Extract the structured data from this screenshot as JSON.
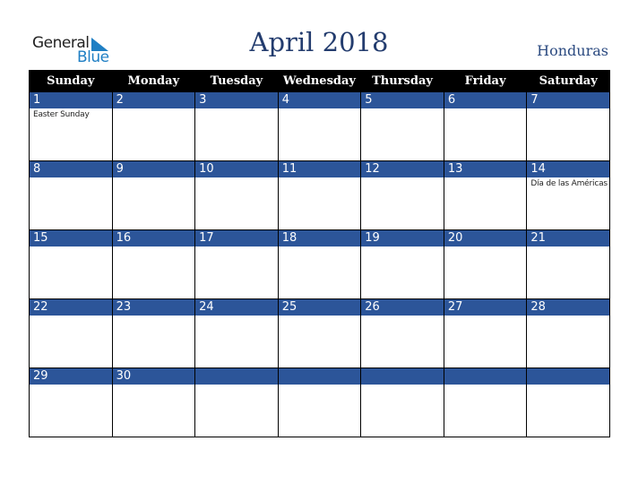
{
  "logo": {
    "word1": "General",
    "word2": "Blue",
    "icon": "triangle-flag-icon"
  },
  "title": "April 2018",
  "country": "Honduras",
  "colors": {
    "header_bg": "#000000",
    "day_bar": "#2c5599",
    "title": "#233c6e",
    "logo_blue": "#1f7fc4"
  },
  "weekdays": [
    "Sunday",
    "Monday",
    "Tuesday",
    "Wednesday",
    "Thursday",
    "Friday",
    "Saturday"
  ],
  "weeks": [
    [
      {
        "day": "1",
        "holiday": "Easter Sunday"
      },
      {
        "day": "2",
        "holiday": ""
      },
      {
        "day": "3",
        "holiday": ""
      },
      {
        "day": "4",
        "holiday": ""
      },
      {
        "day": "5",
        "holiday": ""
      },
      {
        "day": "6",
        "holiday": ""
      },
      {
        "day": "7",
        "holiday": ""
      }
    ],
    [
      {
        "day": "8",
        "holiday": ""
      },
      {
        "day": "9",
        "holiday": ""
      },
      {
        "day": "10",
        "holiday": ""
      },
      {
        "day": "11",
        "holiday": ""
      },
      {
        "day": "12",
        "holiday": ""
      },
      {
        "day": "13",
        "holiday": ""
      },
      {
        "day": "14",
        "holiday": "Día de las Américas"
      }
    ],
    [
      {
        "day": "15",
        "holiday": ""
      },
      {
        "day": "16",
        "holiday": ""
      },
      {
        "day": "17",
        "holiday": ""
      },
      {
        "day": "18",
        "holiday": ""
      },
      {
        "day": "19",
        "holiday": ""
      },
      {
        "day": "20",
        "holiday": ""
      },
      {
        "day": "21",
        "holiday": ""
      }
    ],
    [
      {
        "day": "22",
        "holiday": ""
      },
      {
        "day": "23",
        "holiday": ""
      },
      {
        "day": "24",
        "holiday": ""
      },
      {
        "day": "25",
        "holiday": ""
      },
      {
        "day": "26",
        "holiday": ""
      },
      {
        "day": "27",
        "holiday": ""
      },
      {
        "day": "28",
        "holiday": ""
      }
    ],
    [
      {
        "day": "29",
        "holiday": ""
      },
      {
        "day": "30",
        "holiday": ""
      },
      {
        "day": "",
        "holiday": ""
      },
      {
        "day": "",
        "holiday": ""
      },
      {
        "day": "",
        "holiday": ""
      },
      {
        "day": "",
        "holiday": ""
      },
      {
        "day": "",
        "holiday": ""
      }
    ]
  ]
}
